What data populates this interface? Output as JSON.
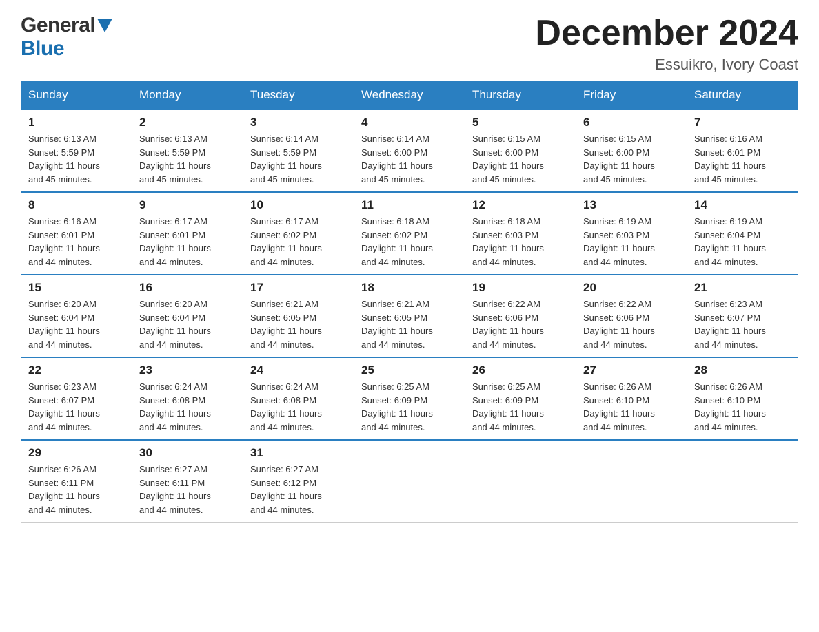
{
  "logo": {
    "general": "General",
    "blue": "Blue",
    "arrow": "▼"
  },
  "title": "December 2024",
  "subtitle": "Essuikro, Ivory Coast",
  "headers": [
    "Sunday",
    "Monday",
    "Tuesday",
    "Wednesday",
    "Thursday",
    "Friday",
    "Saturday"
  ],
  "weeks": [
    [
      {
        "day": "1",
        "sunrise": "6:13 AM",
        "sunset": "5:59 PM",
        "daylight": "11 hours and 45 minutes."
      },
      {
        "day": "2",
        "sunrise": "6:13 AM",
        "sunset": "5:59 PM",
        "daylight": "11 hours and 45 minutes."
      },
      {
        "day": "3",
        "sunrise": "6:14 AM",
        "sunset": "5:59 PM",
        "daylight": "11 hours and 45 minutes."
      },
      {
        "day": "4",
        "sunrise": "6:14 AM",
        "sunset": "6:00 PM",
        "daylight": "11 hours and 45 minutes."
      },
      {
        "day": "5",
        "sunrise": "6:15 AM",
        "sunset": "6:00 PM",
        "daylight": "11 hours and 45 minutes."
      },
      {
        "day": "6",
        "sunrise": "6:15 AM",
        "sunset": "6:00 PM",
        "daylight": "11 hours and 45 minutes."
      },
      {
        "day": "7",
        "sunrise": "6:16 AM",
        "sunset": "6:01 PM",
        "daylight": "11 hours and 45 minutes."
      }
    ],
    [
      {
        "day": "8",
        "sunrise": "6:16 AM",
        "sunset": "6:01 PM",
        "daylight": "11 hours and 44 minutes."
      },
      {
        "day": "9",
        "sunrise": "6:17 AM",
        "sunset": "6:01 PM",
        "daylight": "11 hours and 44 minutes."
      },
      {
        "day": "10",
        "sunrise": "6:17 AM",
        "sunset": "6:02 PM",
        "daylight": "11 hours and 44 minutes."
      },
      {
        "day": "11",
        "sunrise": "6:18 AM",
        "sunset": "6:02 PM",
        "daylight": "11 hours and 44 minutes."
      },
      {
        "day": "12",
        "sunrise": "6:18 AM",
        "sunset": "6:03 PM",
        "daylight": "11 hours and 44 minutes."
      },
      {
        "day": "13",
        "sunrise": "6:19 AM",
        "sunset": "6:03 PM",
        "daylight": "11 hours and 44 minutes."
      },
      {
        "day": "14",
        "sunrise": "6:19 AM",
        "sunset": "6:04 PM",
        "daylight": "11 hours and 44 minutes."
      }
    ],
    [
      {
        "day": "15",
        "sunrise": "6:20 AM",
        "sunset": "6:04 PM",
        "daylight": "11 hours and 44 minutes."
      },
      {
        "day": "16",
        "sunrise": "6:20 AM",
        "sunset": "6:04 PM",
        "daylight": "11 hours and 44 minutes."
      },
      {
        "day": "17",
        "sunrise": "6:21 AM",
        "sunset": "6:05 PM",
        "daylight": "11 hours and 44 minutes."
      },
      {
        "day": "18",
        "sunrise": "6:21 AM",
        "sunset": "6:05 PM",
        "daylight": "11 hours and 44 minutes."
      },
      {
        "day": "19",
        "sunrise": "6:22 AM",
        "sunset": "6:06 PM",
        "daylight": "11 hours and 44 minutes."
      },
      {
        "day": "20",
        "sunrise": "6:22 AM",
        "sunset": "6:06 PM",
        "daylight": "11 hours and 44 minutes."
      },
      {
        "day": "21",
        "sunrise": "6:23 AM",
        "sunset": "6:07 PM",
        "daylight": "11 hours and 44 minutes."
      }
    ],
    [
      {
        "day": "22",
        "sunrise": "6:23 AM",
        "sunset": "6:07 PM",
        "daylight": "11 hours and 44 minutes."
      },
      {
        "day": "23",
        "sunrise": "6:24 AM",
        "sunset": "6:08 PM",
        "daylight": "11 hours and 44 minutes."
      },
      {
        "day": "24",
        "sunrise": "6:24 AM",
        "sunset": "6:08 PM",
        "daylight": "11 hours and 44 minutes."
      },
      {
        "day": "25",
        "sunrise": "6:25 AM",
        "sunset": "6:09 PM",
        "daylight": "11 hours and 44 minutes."
      },
      {
        "day": "26",
        "sunrise": "6:25 AM",
        "sunset": "6:09 PM",
        "daylight": "11 hours and 44 minutes."
      },
      {
        "day": "27",
        "sunrise": "6:26 AM",
        "sunset": "6:10 PM",
        "daylight": "11 hours and 44 minutes."
      },
      {
        "day": "28",
        "sunrise": "6:26 AM",
        "sunset": "6:10 PM",
        "daylight": "11 hours and 44 minutes."
      }
    ],
    [
      {
        "day": "29",
        "sunrise": "6:26 AM",
        "sunset": "6:11 PM",
        "daylight": "11 hours and 44 minutes."
      },
      {
        "day": "30",
        "sunrise": "6:27 AM",
        "sunset": "6:11 PM",
        "daylight": "11 hours and 44 minutes."
      },
      {
        "day": "31",
        "sunrise": "6:27 AM",
        "sunset": "6:12 PM",
        "daylight": "11 hours and 44 minutes."
      },
      null,
      null,
      null,
      null
    ]
  ],
  "labels": {
    "sunrise": "Sunrise:",
    "sunset": "Sunset:",
    "daylight": "Daylight:"
  }
}
